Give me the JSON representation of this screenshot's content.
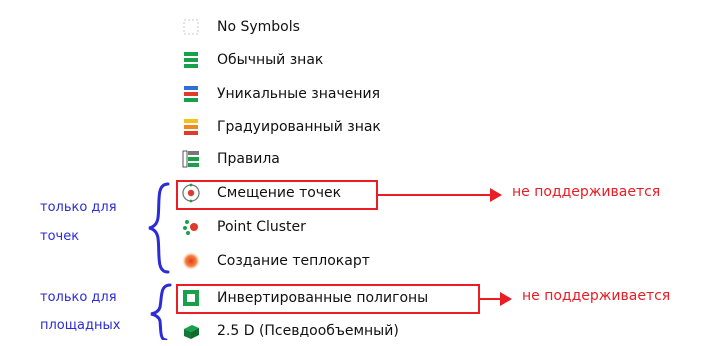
{
  "menu": {
    "items": [
      {
        "label": "No Symbols",
        "icon": "no-symbols-icon"
      },
      {
        "label": "Обычный знак",
        "icon": "single-symbol-icon"
      },
      {
        "label": "Уникальные значения",
        "icon": "categorized-icon"
      },
      {
        "label": "Градуированный знак",
        "icon": "graduated-icon"
      },
      {
        "label": "Правила",
        "icon": "rule-based-icon"
      },
      {
        "label": "Смещение точек",
        "icon": "point-displacement-icon"
      },
      {
        "label": "Point Cluster",
        "icon": "point-cluster-icon"
      },
      {
        "label": "Создание теплокарт",
        "icon": "heatmap-icon"
      },
      {
        "label": "Инвертированные полигоны",
        "icon": "inverted-polygons-icon"
      },
      {
        "label": "2.5 D  (Псевдообъемный)",
        "icon": "2-5d-icon"
      }
    ]
  },
  "annotations": {
    "not_supported_1": "не поддерживается",
    "not_supported_2": "не поддерживается",
    "group_points_line1": "только для",
    "group_points_line2": "точек",
    "group_polygons_line1": "только для",
    "group_polygons_line2": "площадных"
  },
  "colors": {
    "highlight": "#ea1c24",
    "group_label": "#2b2bd8",
    "green": "#1aa04a",
    "blue": "#2f6fd8",
    "orange": "#f08a1c",
    "red": "#e03a2a"
  }
}
